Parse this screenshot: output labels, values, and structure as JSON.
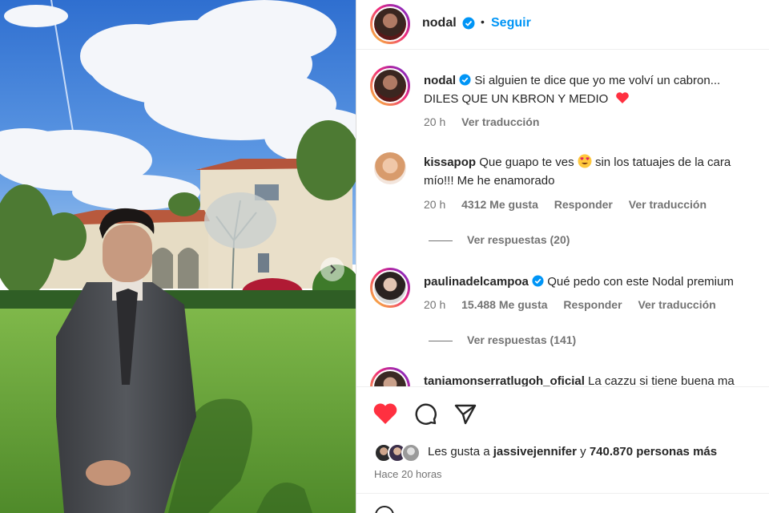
{
  "post": {
    "username": "nodal",
    "follow_label": "Seguir",
    "dot": "•"
  },
  "caption": {
    "username": "nodal",
    "line1": "Si alguien te dice que yo me volví un cabron...",
    "line2": "DILES QUE UN KBRON Y MEDIO",
    "time": "20 h",
    "translate": "Ver traducción"
  },
  "comments": [
    {
      "username": "kissapop",
      "text1": "Que guapo te ves",
      "text1b": "sin los tatuajes de la cara",
      "text2": "mío!!! Me he enamorado",
      "time": "20 h",
      "likes": "4312 Me gusta",
      "reply": "Responder",
      "translate": "Ver traducción",
      "view_replies": "Ver respuestas (20)"
    },
    {
      "username": "paulinadelcampoa",
      "text1": "Qué pedo con este Nodal premium",
      "time": "20 h",
      "likes": "15.488 Me gusta",
      "reply": "Responder",
      "translate": "Ver traducción",
      "view_replies": "Ver respuestas (141)"
    },
    {
      "username": "taniamonserratlugoh_oficial",
      "text1": "La cazzu si tiene buena ma"
    }
  ],
  "likes_line": {
    "prefix": "Les gusta a",
    "user": "jassivejennifer",
    "middle": "y",
    "count": "740.870 personas más"
  },
  "posted": "Hace 20 horas",
  "colors": {
    "accent": "#0095f6",
    "heart": "#ff3040",
    "verified": "#0095f6"
  },
  "icons": [
    "heart-icon",
    "comment-icon",
    "share-icon",
    "verified-icon",
    "heart-emoji",
    "heart-eyes-emoji",
    "chevron-right-icon"
  ]
}
